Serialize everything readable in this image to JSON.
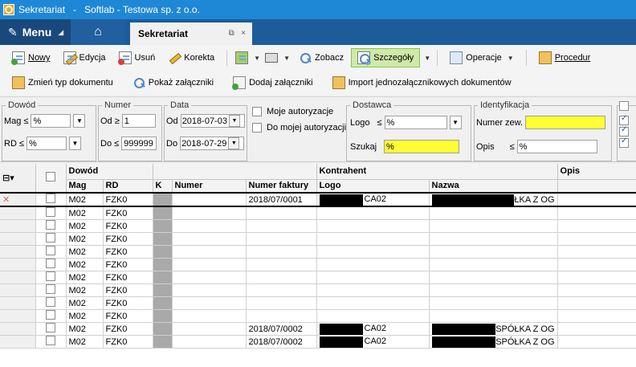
{
  "window": {
    "title_app": "Sekretariat",
    "title_sep": "-",
    "title_company": "Softlab - Testowa sp. z o.o."
  },
  "tabs": {
    "menu": "Menu",
    "active_tab": "Sekretariat"
  },
  "toolbar1": {
    "nowy": "Nowy",
    "edycja": "Edycja",
    "usun": "Usuń",
    "korekta": "Korekta",
    "zobacz": "Zobacz",
    "szczegoly": "Szczegóły",
    "operacje": "Operacje",
    "procedury": "Procedur"
  },
  "toolbar2": {
    "zmien_typ": "Zmień typ dokumentu",
    "pokaz": "Pokaż załączniki",
    "dodaj": "Dodaj załączniki",
    "import": "Import jednozałącznikowych dokumentów"
  },
  "filters": {
    "dowod": {
      "label": "Dowód",
      "mag_label": "Mag",
      "mag_value": "%",
      "rd_label": "RD",
      "rd_value": "%"
    },
    "numer": {
      "label": "Numer",
      "od_label": "Od ≥",
      "od_value": "1",
      "do_label": "Do ≤",
      "do_value": "999999"
    },
    "data": {
      "label": "Data",
      "od_label": "Od",
      "od_value": "2018-07-03",
      "do_label": "Do",
      "do_value": "2018-07-29"
    },
    "moje_autoryzacje": "Moje autoryzacje",
    "do_mojej": "Do mojej autoryzacji",
    "dostawca": {
      "label": "Dostawca",
      "logo_label": "Logo",
      "logo_value": "%",
      "szukaj_label": "Szukaj",
      "szukaj_value": "%"
    },
    "identyfikacja": {
      "label": "Identyfikacja",
      "numer_zew": "Numer zew.",
      "numer_zew_value": "",
      "opis_label": "Opis",
      "opis_value": "%"
    },
    "le": "≤"
  },
  "grid": {
    "group_headers": {
      "dowod": "Dowód",
      "kontrahent": "Kontrahent",
      "opis": "Opis"
    },
    "columns": {
      "mag": "Mag",
      "rd": "RD",
      "k": "K",
      "numer": "Numer",
      "numer_faktury": "Numer faktury",
      "logo": "Logo",
      "nazwa": "Nazwa"
    },
    "rows": [
      {
        "mag": "M02",
        "rd": "FZK0",
        "numer_faktury": "2018/07/0001",
        "logo_suffix": "CA02",
        "nazwa_suffix": "ŁKA Z OG"
      },
      {
        "mag": "M02",
        "rd": "FZK0",
        "numer_faktury": "",
        "logo_suffix": "",
        "nazwa_suffix": ""
      },
      {
        "mag": "M02",
        "rd": "FZK0",
        "numer_faktury": "",
        "logo_suffix": "",
        "nazwa_suffix": ""
      },
      {
        "mag": "M02",
        "rd": "FZK0",
        "numer_faktury": "",
        "logo_suffix": "",
        "nazwa_suffix": ""
      },
      {
        "mag": "M02",
        "rd": "FZK0",
        "numer_faktury": "",
        "logo_suffix": "",
        "nazwa_suffix": ""
      },
      {
        "mag": "M02",
        "rd": "FZK0",
        "numer_faktury": "",
        "logo_suffix": "",
        "nazwa_suffix": ""
      },
      {
        "mag": "M02",
        "rd": "FZK0",
        "numer_faktury": "",
        "logo_suffix": "",
        "nazwa_suffix": ""
      },
      {
        "mag": "M02",
        "rd": "FZK0",
        "numer_faktury": "",
        "logo_suffix": "",
        "nazwa_suffix": ""
      },
      {
        "mag": "M02",
        "rd": "FZK0",
        "numer_faktury": "",
        "logo_suffix": "",
        "nazwa_suffix": ""
      },
      {
        "mag": "M02",
        "rd": "FZK0",
        "numer_faktury": "",
        "logo_suffix": "",
        "nazwa_suffix": ""
      },
      {
        "mag": "M02",
        "rd": "FZK0",
        "numer_faktury": "2018/07/0002",
        "logo_suffix": "CA02",
        "nazwa_suffix": "SPÓŁKA Z OG"
      },
      {
        "mag": "M02",
        "rd": "FZK0",
        "numer_faktury": "2018/07/0002",
        "logo_suffix": "CA02",
        "nazwa_suffix": "SPÓŁKA Z OG"
      }
    ]
  }
}
